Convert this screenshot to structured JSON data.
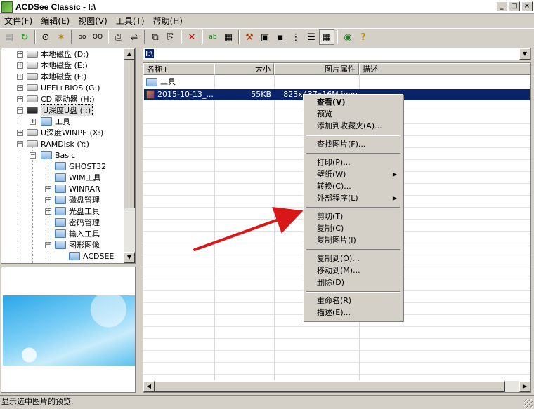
{
  "window": {
    "title": "ACDSee Classic - I:\\"
  },
  "menu": [
    "文件(F)",
    "编辑(E)",
    "视图(V)",
    "工具(T)",
    "帮助(H)"
  ],
  "tree": {
    "items": [
      {
        "label": "本地磁盘 (D:)",
        "type": "drive"
      },
      {
        "label": "本地磁盘 (E:)",
        "type": "drive"
      },
      {
        "label": "本地磁盘 (F:)",
        "type": "drive"
      },
      {
        "label": "UEFI+BIOS (G:)",
        "type": "drive"
      },
      {
        "label": "CD 驱动器 (H:)",
        "type": "drive"
      },
      {
        "label": "U深度U盘 (I:)",
        "type": "drive"
      },
      {
        "label": "工具",
        "type": "folder"
      },
      {
        "label": "U深度WINPE (X:)",
        "type": "drive"
      },
      {
        "label": "RAMDisk (Y:)",
        "type": "drive"
      },
      {
        "label": "Basic",
        "type": "folder"
      },
      {
        "label": "GHOST32",
        "type": "folder"
      },
      {
        "label": "WIM工具",
        "type": "folder"
      },
      {
        "label": "WINRAR",
        "type": "folder"
      },
      {
        "label": "磁盘管理",
        "type": "folder"
      },
      {
        "label": "光盘工具",
        "type": "folder"
      },
      {
        "label": "密码管理",
        "type": "folder"
      },
      {
        "label": "输入工具",
        "type": "folder"
      },
      {
        "label": "图形图像",
        "type": "folder"
      },
      {
        "label": "ACDSEE",
        "type": "folder"
      }
    ]
  },
  "path": "I:\\",
  "filelist": {
    "columns": [
      "名称+",
      "大小",
      "图片属性",
      "描述"
    ],
    "rows": [
      {
        "name": "工具",
        "size": "",
        "props": "",
        "desc": ""
      },
      {
        "name": "2015-10-13_...",
        "size": "55KB",
        "props": "823x437x16M jpeg",
        "desc": ""
      }
    ]
  },
  "context_menu": {
    "items": [
      "查看(V)",
      "预览",
      "添加到收藏夹(A)...",
      "查找图片(F)...",
      "打印(P)...",
      "壁纸(W)",
      "转换(C)...",
      "外部程序(L)",
      "剪切(T)",
      "复制(C)",
      "复制图片(I)",
      "复制到(O)...",
      "移动到(M)...",
      "删除(D)",
      "重命名(R)",
      "描述(E)..."
    ]
  },
  "status": "显示选中图片的预览."
}
